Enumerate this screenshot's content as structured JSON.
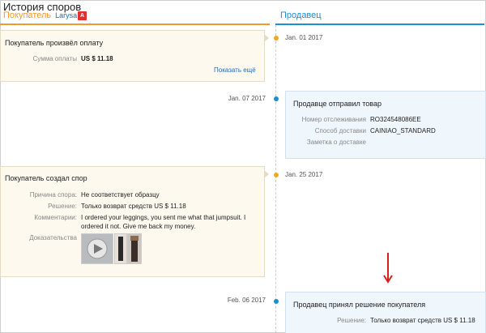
{
  "header": {
    "title": "История споров",
    "buyer_label": "Покупатель",
    "buyer_name": "Larysa",
    "seller_label": "Продавец"
  },
  "events": [
    {
      "date": "Jan. 01 2017",
      "title": "Покупатель произвёл оплату",
      "rows": [
        {
          "label": "Сумма оплаты",
          "value": "US $ 11.18"
        }
      ],
      "link": "Показать ещё"
    },
    {
      "date": "Jan. 07 2017",
      "title": "Продавце отправил товар",
      "rows": [
        {
          "label": "Номер отслеживания",
          "value": "RO324548086EE"
        },
        {
          "label": "Способ доставки",
          "value": "CAINIAO_STANDARD"
        },
        {
          "label": "Заметка о доставке",
          "value": ""
        }
      ]
    },
    {
      "date": "Jan. 25 2017",
      "title": "Покупатель создал спор",
      "rows": [
        {
          "label": "Причина спора:",
          "value": "Не соответствует образцу"
        },
        {
          "label": "Решение:",
          "value": "Только возврат средств US $ 11.18"
        },
        {
          "label": "Комментарии:",
          "value_lines": [
            "I ordered your leggings, you sent me what that jumpsuit. I",
            "ordered it not. Give me back my money."
          ]
        },
        {
          "label": "Доказательства",
          "value": ""
        }
      ]
    },
    {
      "date": "Feb. 06 2017",
      "title": "Продавец принял решение покупателя",
      "rows": [
        {
          "label": "Решение:",
          "value": "Только возврат средств US $ 11.18"
        }
      ]
    }
  ],
  "colors": {
    "buyer": "#f09a2c",
    "seller": "#1a8fd4",
    "annotation_arrow": "#d81e1e"
  }
}
